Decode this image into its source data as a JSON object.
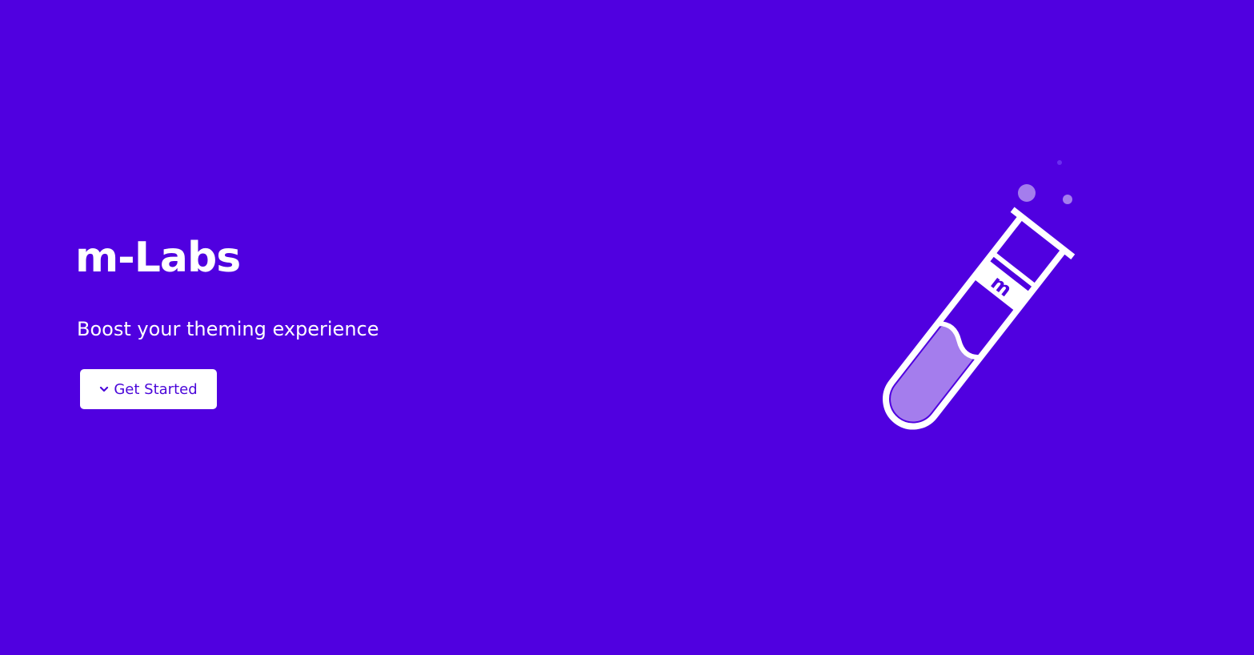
{
  "hero": {
    "title": "m-Labs",
    "tagline": "Boost your theming experience",
    "cta_label": "Get Started",
    "cta_icon": "chevron-down-icon"
  },
  "illustration": {
    "icon": "test-tube-icon",
    "tube_label": "m",
    "liquid_color": "#a47ded",
    "bubble_color": "#a47ded"
  },
  "colors": {
    "background": "#5000e0",
    "accent": "#4a06d9",
    "text": "#ffffff"
  }
}
